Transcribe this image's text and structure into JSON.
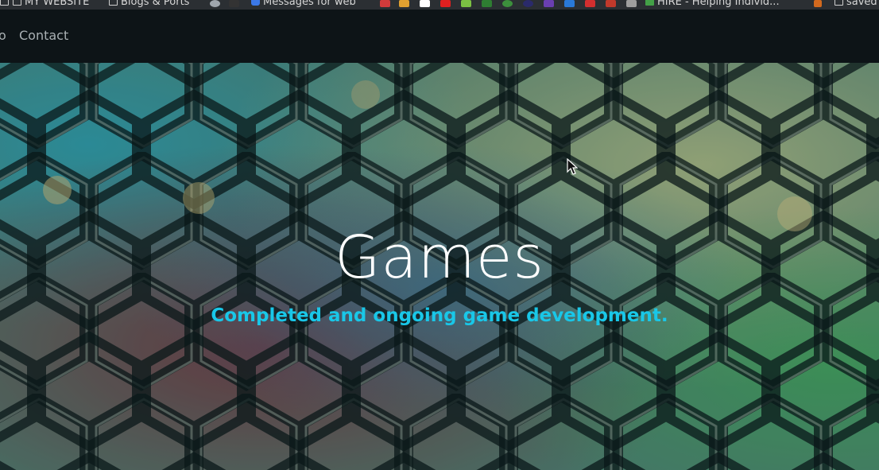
{
  "bookmarks_bar": {
    "items": [
      {
        "label": "MY WEBSITE",
        "icon": "folder-icon"
      },
      {
        "label": "Blogs & Ports",
        "icon": "folder-icon"
      },
      {
        "label": "Messages for web",
        "icon": "messages-icon"
      },
      {
        "label": "HIRE - Helping Individ...",
        "icon": "site-icon"
      },
      {
        "label": "saved",
        "icon": "folder-icon"
      }
    ],
    "favicon_colors": [
      "#d23b3b",
      "#e0a030",
      "#ffffff",
      "#e02020",
      "#7bc043",
      "#2e7d32",
      "#3c8f3c",
      "#2a2a6a",
      "#6a3fb0",
      "#2979d8",
      "#d32f2f",
      "#c0392b",
      "#9e9e9e",
      "#43a047"
    ]
  },
  "nav": {
    "links": [
      {
        "label": "o"
      },
      {
        "label": "Contact"
      }
    ]
  },
  "hero": {
    "title": "Games",
    "subtitle": "Completed and ongoing game development.",
    "subtitle_color": "#19c7e8",
    "background": "hexagon-pattern-image"
  }
}
